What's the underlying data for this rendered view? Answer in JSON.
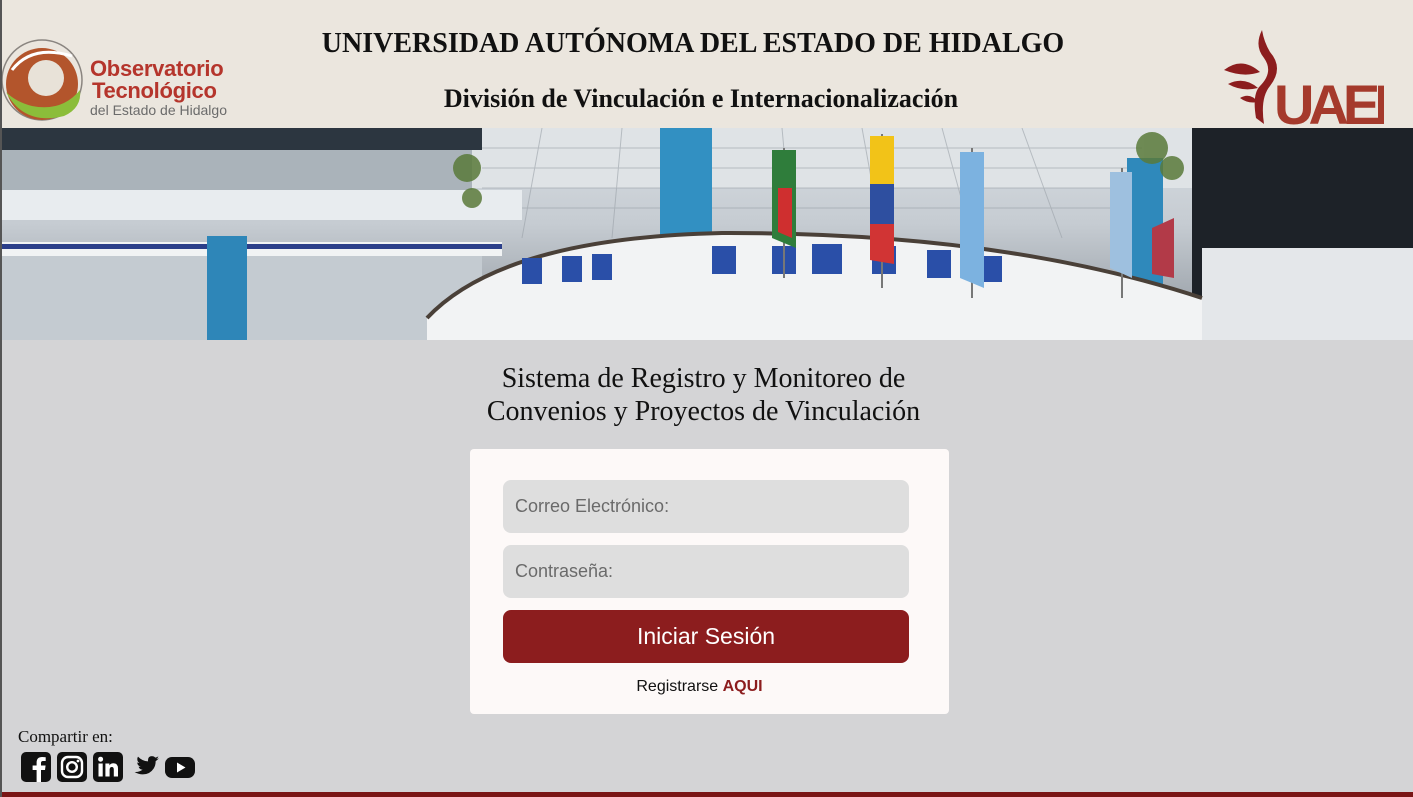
{
  "header": {
    "logo_left": {
      "line1": "Observatorio",
      "line2": "Tecnológico",
      "line3": "del Estado de Hidalgo"
    },
    "university_title": "UNIVERSIDAD AUTÓNOMA DEL ESTADO DE HIDALGO",
    "division_title": "División de Vinculación e Internacionalización",
    "logo_right_text": "UAEH"
  },
  "main": {
    "system_title_line1": "Sistema de Registro y Monitoreo de",
    "system_title_line2": "Convenios y Proyectos de Vinculación"
  },
  "login": {
    "email_placeholder": "Correo Electrónico:",
    "email_value": "",
    "password_placeholder": "Contraseña:",
    "password_value": "",
    "submit_label": "Iniciar Sesión",
    "register_text": "Registrarse",
    "register_link": "AQUI"
  },
  "share": {
    "label": "Compartir en:",
    "icons": [
      "facebook-icon",
      "instagram-icon",
      "linkedin-icon",
      "twitter-icon",
      "youtube-icon"
    ]
  },
  "colors": {
    "brand": "#8c1d1e",
    "header_bg": "#ebe6de",
    "page_bg": "#d4d4d6",
    "card_bg": "#fdf9f8",
    "logo_red": "#b5352c"
  }
}
